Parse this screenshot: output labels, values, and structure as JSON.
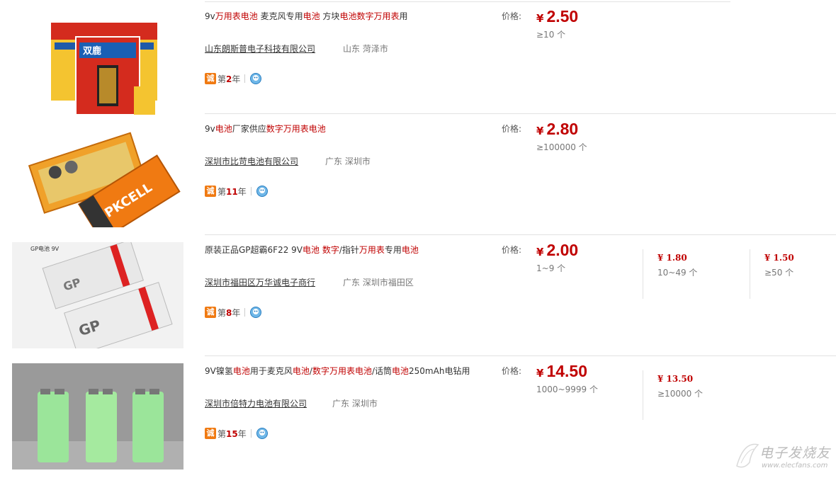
{
  "labels": {
    "price_label": "价格:",
    "currency": "¥",
    "years_prefix": "第",
    "years_suffix": "年",
    "cheng_badge": "诚"
  },
  "listings": [
    {
      "title_parts": [
        {
          "text": "9v",
          "hl": false
        },
        {
          "text": "万用表电池",
          "hl": true
        },
        {
          "text": " 麦克风专用",
          "hl": false
        },
        {
          "text": "电池",
          "hl": true
        },
        {
          "text": " 方块",
          "hl": false
        },
        {
          "text": "电池数字万用表",
          "hl": true
        },
        {
          "text": "用",
          "hl": false
        }
      ],
      "company": "山东朗斯普电子科技有限公司",
      "location": "山东 菏泽市",
      "years": "2",
      "price": "2.50",
      "moq": "≥10 个",
      "tiers": [],
      "image": "boxed-battery-icon"
    },
    {
      "title_parts": [
        {
          "text": "9v",
          "hl": false
        },
        {
          "text": "电池",
          "hl": true
        },
        {
          "text": "厂家供应",
          "hl": false
        },
        {
          "text": "数字万用表电池",
          "hl": true
        }
      ],
      "company": "深圳市比苛电池有限公司",
      "location": "广东 深圳市",
      "years": "11",
      "price": "2.80",
      "moq": "≥100000 个",
      "tiers": [],
      "image": "pkcell-battery-icon"
    },
    {
      "title_parts": [
        {
          "text": "原装正品GP超霸6F22 9V",
          "hl": false
        },
        {
          "text": "电池 数字",
          "hl": true
        },
        {
          "text": "/指针",
          "hl": false
        },
        {
          "text": "万用表",
          "hl": true
        },
        {
          "text": "专用",
          "hl": false
        },
        {
          "text": "电池",
          "hl": true
        }
      ],
      "company": "深圳市福田区万华诚电子商行",
      "location": "广东 深圳市福田区",
      "years": "8",
      "price": "2.00",
      "moq": "1~9 个",
      "tiers": [
        {
          "price": "¥ 1.80",
          "moq": "10~49 个"
        },
        {
          "price": "¥ 1.50",
          "moq": "≥50 个"
        }
      ],
      "image": "gp-battery-icon",
      "image_caption": "GP电池 9V"
    },
    {
      "title_parts": [
        {
          "text": "9V镍氢",
          "hl": false
        },
        {
          "text": "电池",
          "hl": true
        },
        {
          "text": "用于麦克风",
          "hl": false
        },
        {
          "text": "电池",
          "hl": true
        },
        {
          "text": "/",
          "hl": false
        },
        {
          "text": "数字万用表电池",
          "hl": true
        },
        {
          "text": "/话筒",
          "hl": false
        },
        {
          "text": "电池",
          "hl": true
        },
        {
          "text": "250mAh电钻用",
          "hl": false
        }
      ],
      "company": "深圳市倍特力电池有限公司",
      "location": "广东 深圳市",
      "years": "15",
      "price": "14.50",
      "moq": "1000~9999 个",
      "tiers": [
        {
          "price": "¥ 13.50",
          "moq": "≥10000 个"
        }
      ],
      "image": "nimh-battery-icon"
    }
  ],
  "watermark": {
    "text": "电子发烧友",
    "url": "www.elecfans.com"
  },
  "colors": {
    "accent_red": "#c00000",
    "badge_orange": "#f07a12",
    "divider": "#e2e2e2"
  }
}
